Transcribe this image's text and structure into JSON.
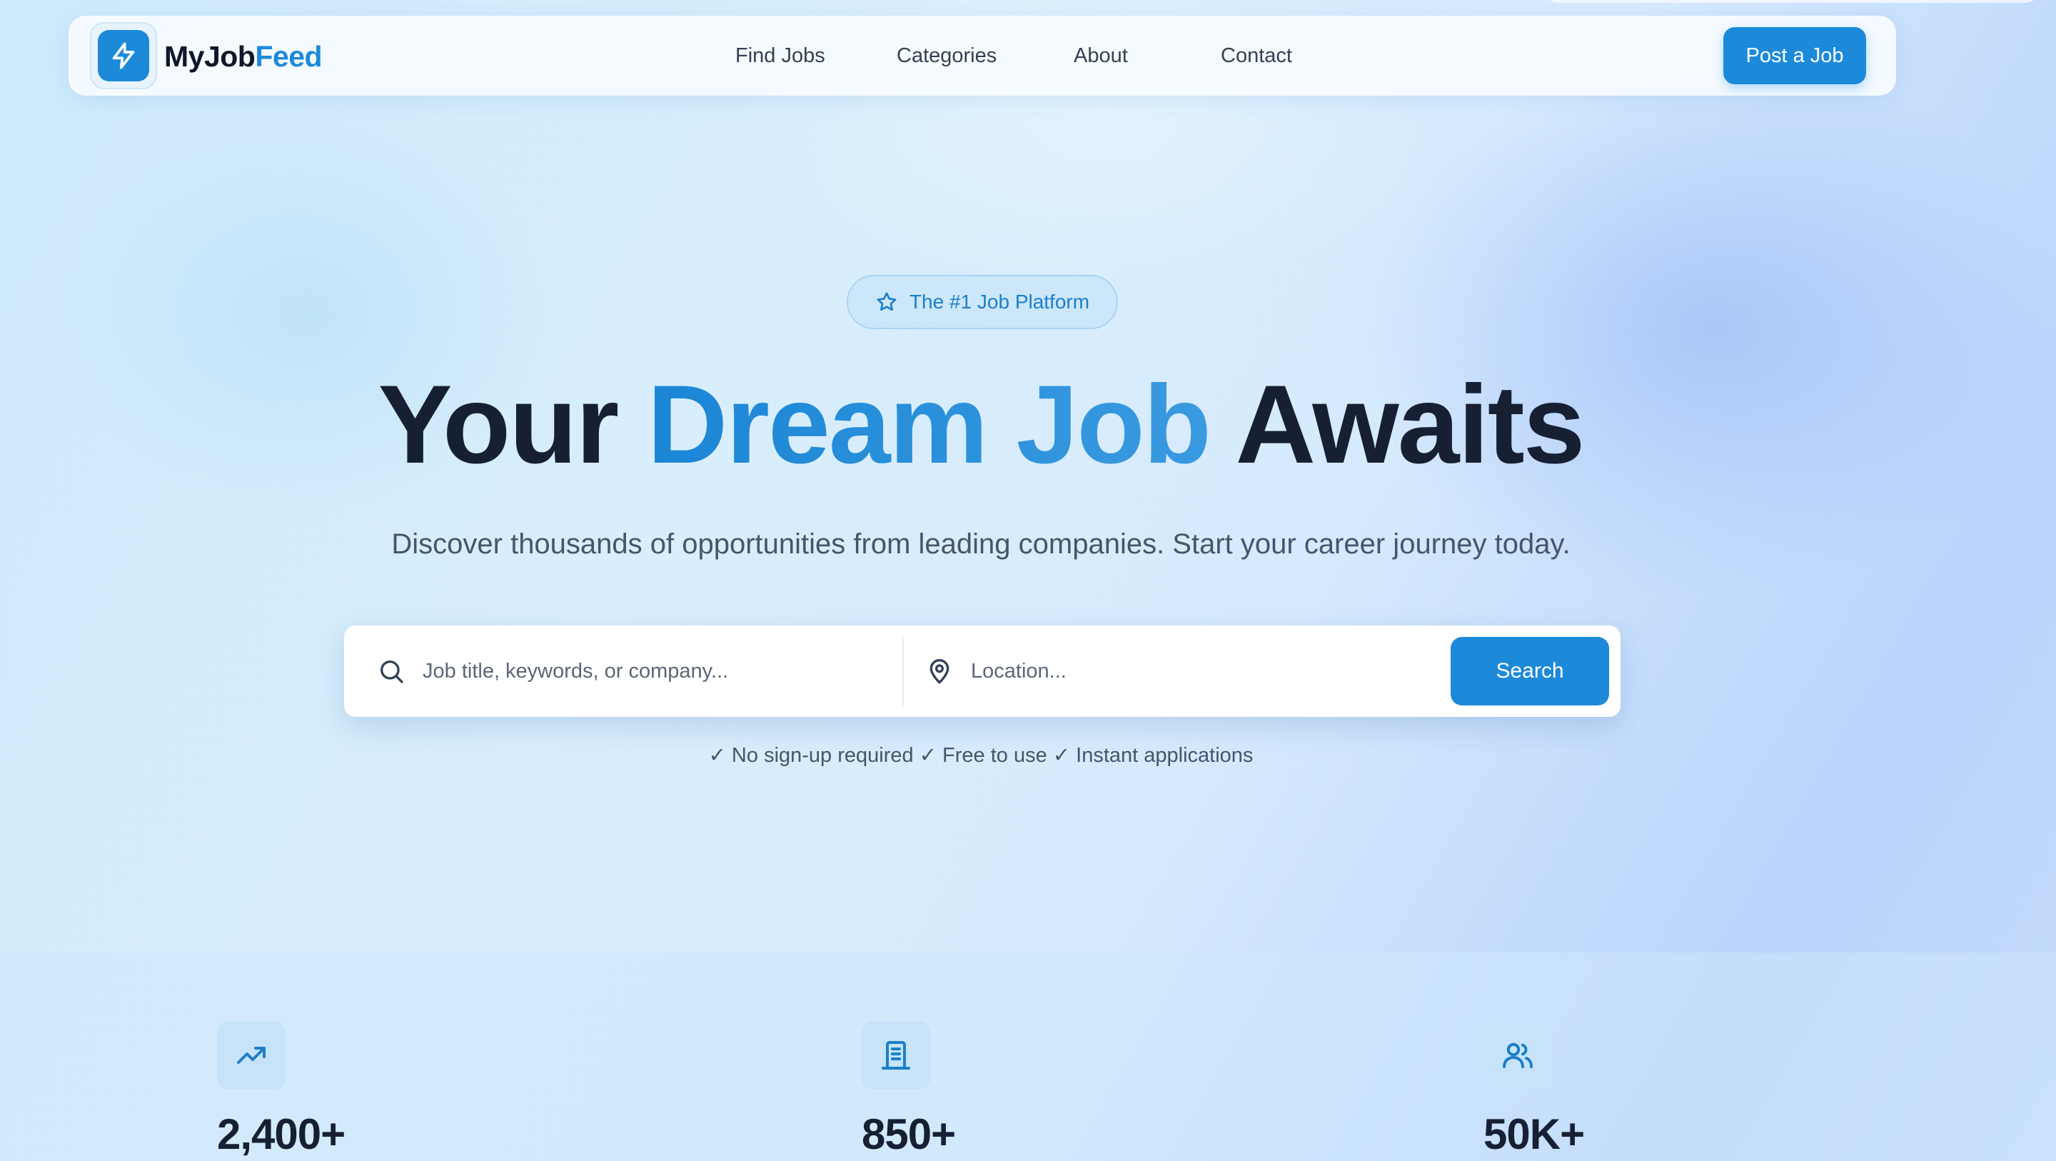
{
  "brand": {
    "name_main": "MyJob",
    "name_accent": "Feed",
    "logo_icon": "lightning-bolt-icon"
  },
  "nav": {
    "links": [
      {
        "label": "Find Jobs"
      },
      {
        "label": "Categories"
      },
      {
        "label": "About"
      },
      {
        "label": "Contact"
      }
    ],
    "cta_label": "Post a Job"
  },
  "hero": {
    "badge": {
      "icon": "star-icon",
      "label": "The #1 Job Platform"
    },
    "headline": {
      "part1": "Your ",
      "highlight": "Dream Job",
      "part2": " Awaits"
    },
    "subtitle": "Discover thousands of opportunities from leading companies. Start your career journey today."
  },
  "search": {
    "keyword_placeholder": "Job title, keywords, or company...",
    "keyword_icon": "search-icon",
    "location_placeholder": "Location...",
    "location_icon": "map-pin-icon",
    "button_label": "Search",
    "perks": "✓ No sign-up required ✓ Free to use ✓ Instant applications"
  },
  "stats": [
    {
      "icon": "trending-up-icon",
      "value": "2,400+"
    },
    {
      "icon": "building-icon",
      "value": "850+"
    },
    {
      "icon": "users-icon",
      "value": "50K+"
    }
  ],
  "colors": {
    "accent": "#1c8ad9",
    "text_dark": "#172033",
    "muted": "#475569"
  }
}
